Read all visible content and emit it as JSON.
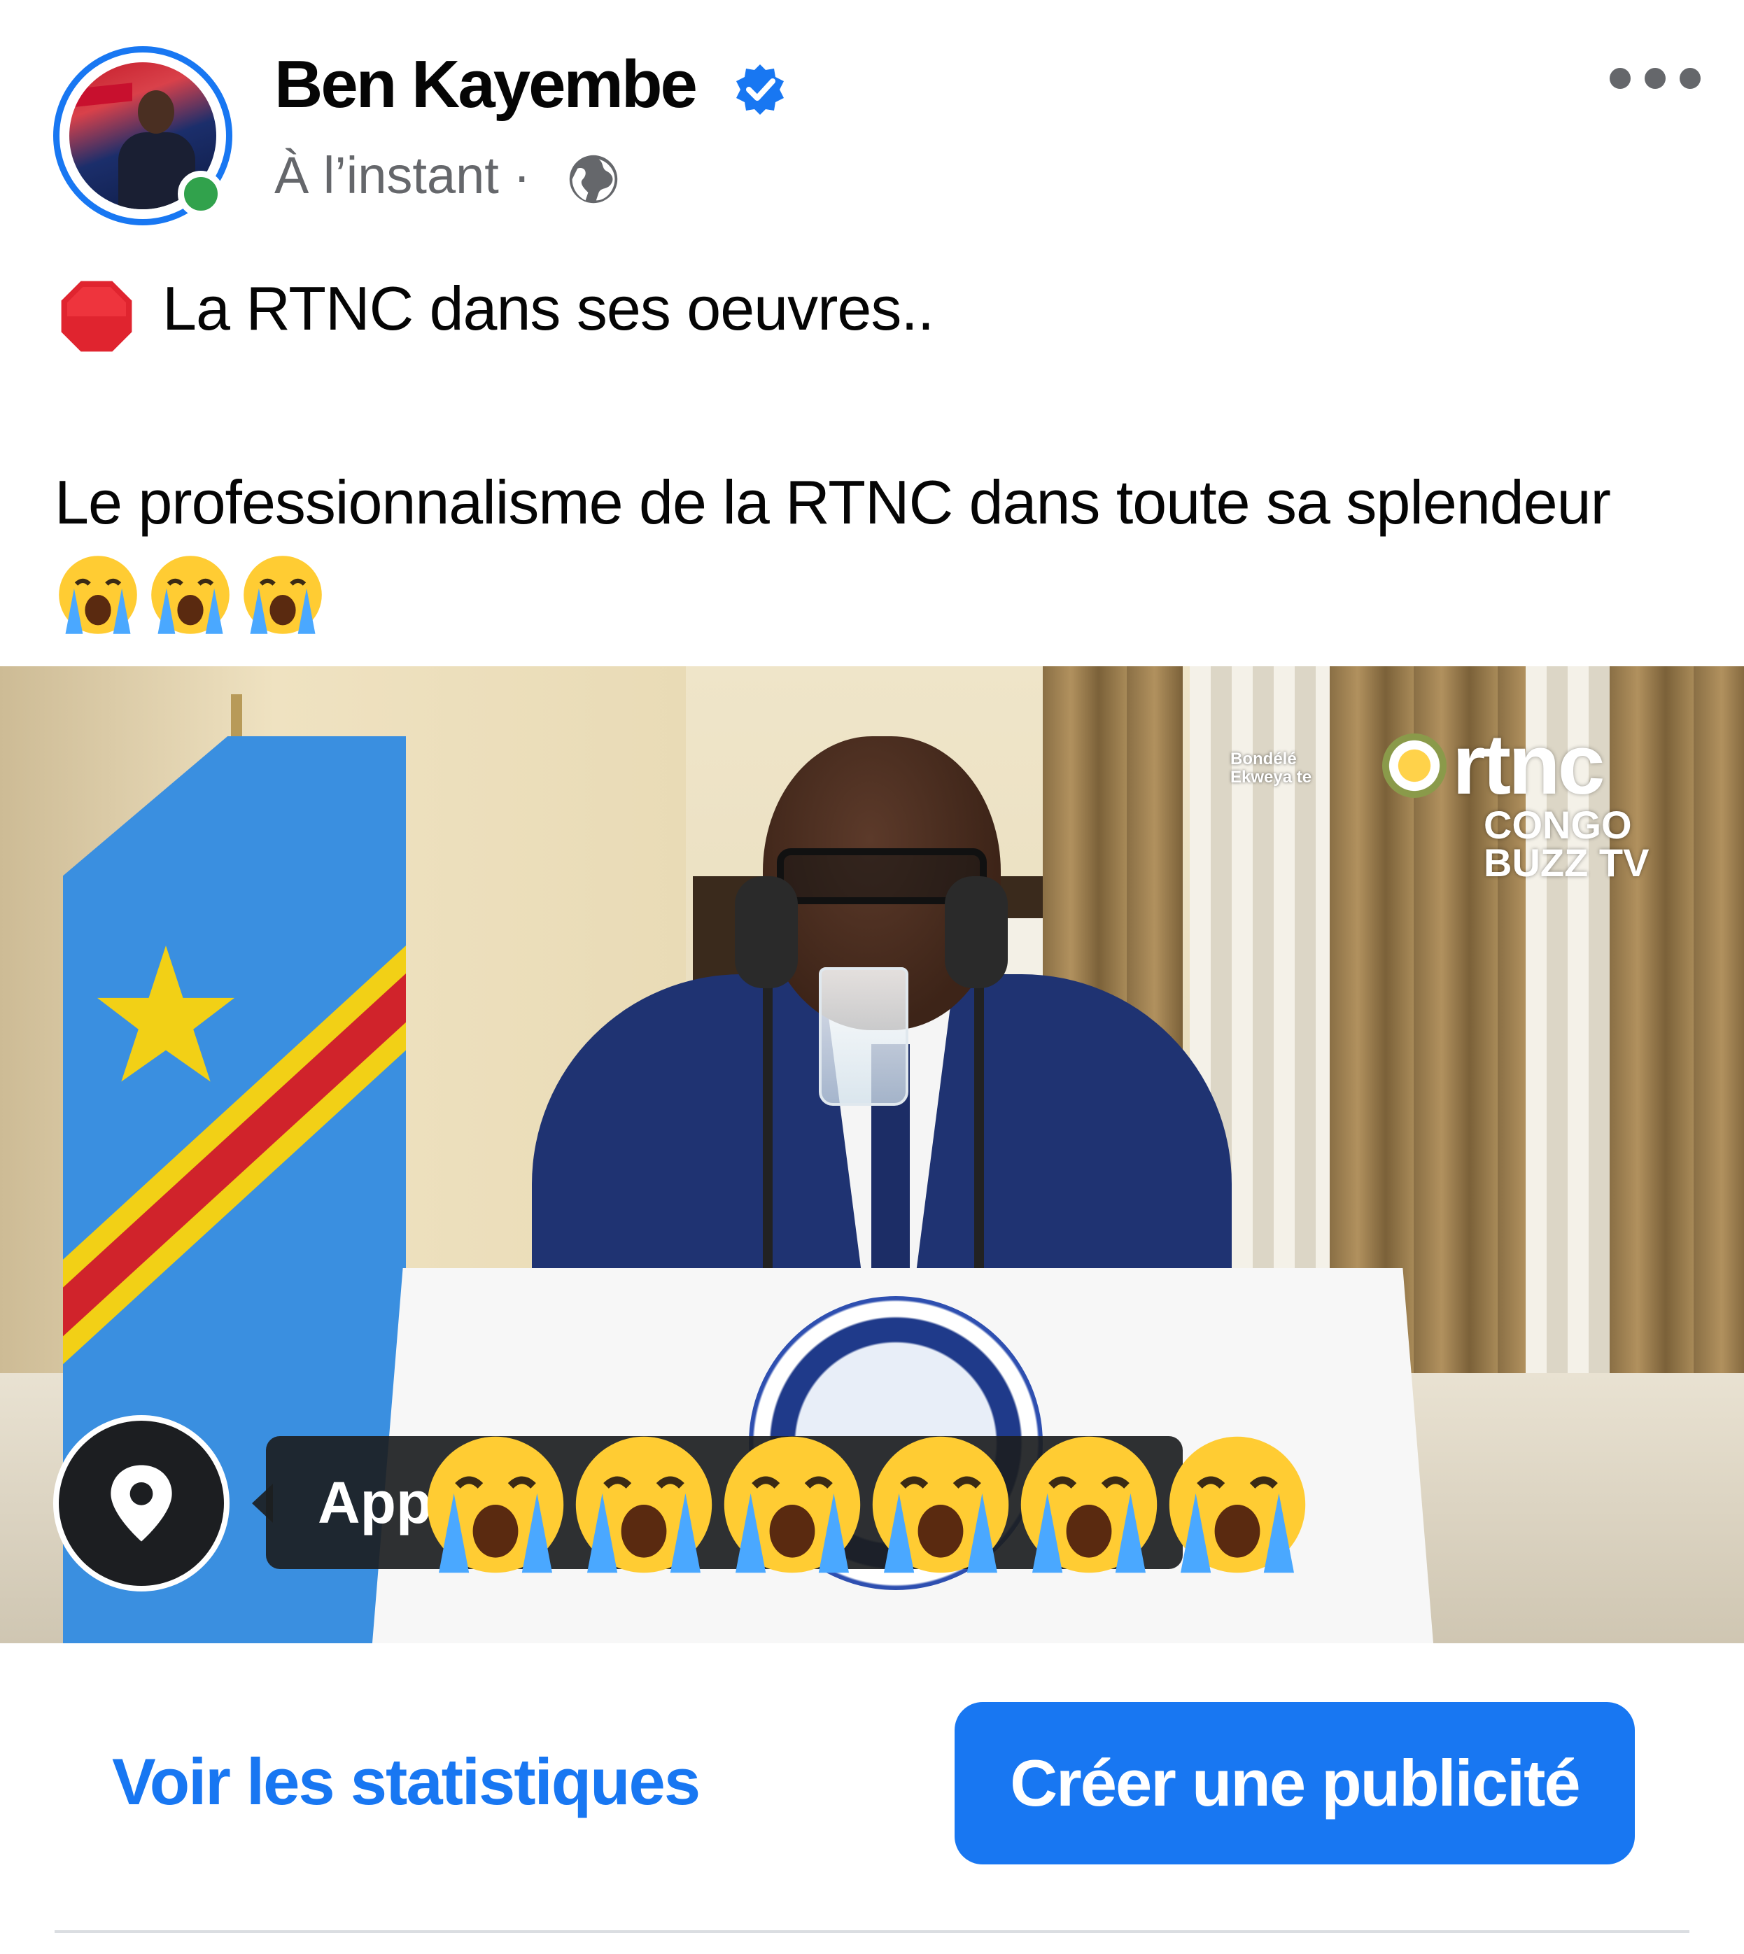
{
  "post": {
    "author_name": "Ben Kayembe",
    "verified": true,
    "timestamp": "À l’instant",
    "separator": "·",
    "audience_icon": "globe-icon",
    "more_icon": "more-options-icon",
    "headline": "La RTNC dans ses oeuvres..",
    "headline_icon": "stop-sign-icon",
    "body": "Le professionnalisme de la RTNC dans toute sa splendeur",
    "body_emojis": [
      "crying-face-icon",
      "crying-face-icon",
      "crying-face-icon"
    ]
  },
  "video": {
    "watermark_brand": "rtnc",
    "watermark_sub_line1": "CONGO",
    "watermark_sub_line2": "BUZZ TV",
    "badge_line1": "Bondélé",
    "badge_line2": "Ekweya te",
    "location_icon": "location-pin-icon",
    "overlay_text": "App",
    "overlay_emojis": [
      "crying-face-icon",
      "crying-face-icon",
      "crying-face-icon",
      "crying-face-icon",
      "crying-face-icon",
      "crying-face-icon"
    ]
  },
  "actions": {
    "stats_label": "Voir les statistiques",
    "ad_label": "Créer une publicité"
  },
  "colors": {
    "accent": "#1877f2",
    "online": "#31a24c",
    "secondary_text": "#65676b"
  }
}
